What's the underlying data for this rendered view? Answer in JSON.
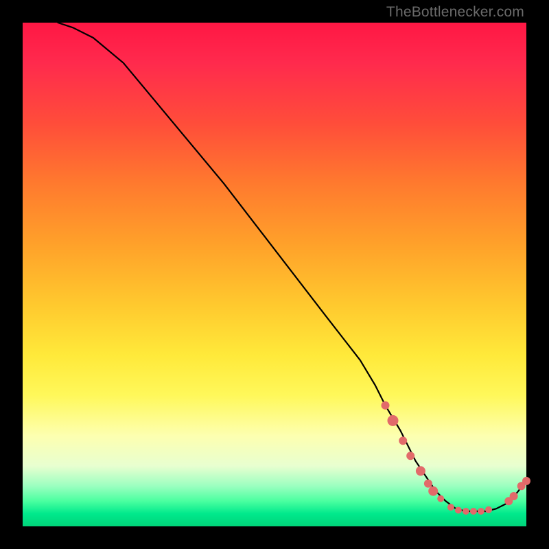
{
  "attribution": "TheBottlenecker.com",
  "chart_data": {
    "type": "line",
    "title": "",
    "xlabel": "",
    "ylabel": "",
    "xlim": [
      0,
      100
    ],
    "ylim": [
      0,
      100
    ],
    "series": [
      {
        "name": "bottleneck-curve",
        "x": [
          7,
          10,
          14,
          20,
          30,
          40,
          50,
          60,
          67,
          70,
          72,
          75,
          78,
          80,
          82,
          84,
          86,
          88,
          90,
          92,
          94,
          96,
          98,
          100
        ],
        "y": [
          100,
          99,
          97,
          92,
          80,
          68,
          55,
          42,
          33,
          28,
          24,
          19,
          13,
          10,
          7,
          5,
          3.5,
          3,
          3,
          3,
          3.5,
          4.5,
          6.5,
          9
        ]
      }
    ],
    "markers": [
      {
        "name": "highlight-points",
        "color": "#e26a6a",
        "points": [
          {
            "x": 72,
            "y": 24,
            "r": 6
          },
          {
            "x": 73.5,
            "y": 21,
            "r": 8
          },
          {
            "x": 75.5,
            "y": 17,
            "r": 6
          },
          {
            "x": 77,
            "y": 14,
            "r": 6
          },
          {
            "x": 79,
            "y": 11,
            "r": 7
          },
          {
            "x": 80.5,
            "y": 8.5,
            "r": 6
          },
          {
            "x": 81.5,
            "y": 7,
            "r": 7
          },
          {
            "x": 83,
            "y": 5.5,
            "r": 5
          },
          {
            "x": 85,
            "y": 3.8,
            "r": 5
          },
          {
            "x": 86.5,
            "y": 3.2,
            "r": 5
          },
          {
            "x": 88,
            "y": 3,
            "r": 5
          },
          {
            "x": 89.5,
            "y": 3,
            "r": 5
          },
          {
            "x": 91,
            "y": 3,
            "r": 5
          },
          {
            "x": 92.5,
            "y": 3.3,
            "r": 5
          },
          {
            "x": 96.5,
            "y": 5,
            "r": 6
          },
          {
            "x": 97.5,
            "y": 6,
            "r": 6
          },
          {
            "x": 99,
            "y": 8,
            "r": 6
          },
          {
            "x": 100,
            "y": 9,
            "r": 6
          }
        ]
      }
    ],
    "annotation": {
      "text": "",
      "color": "#c94f4f",
      "x": 88,
      "y": 3
    }
  }
}
